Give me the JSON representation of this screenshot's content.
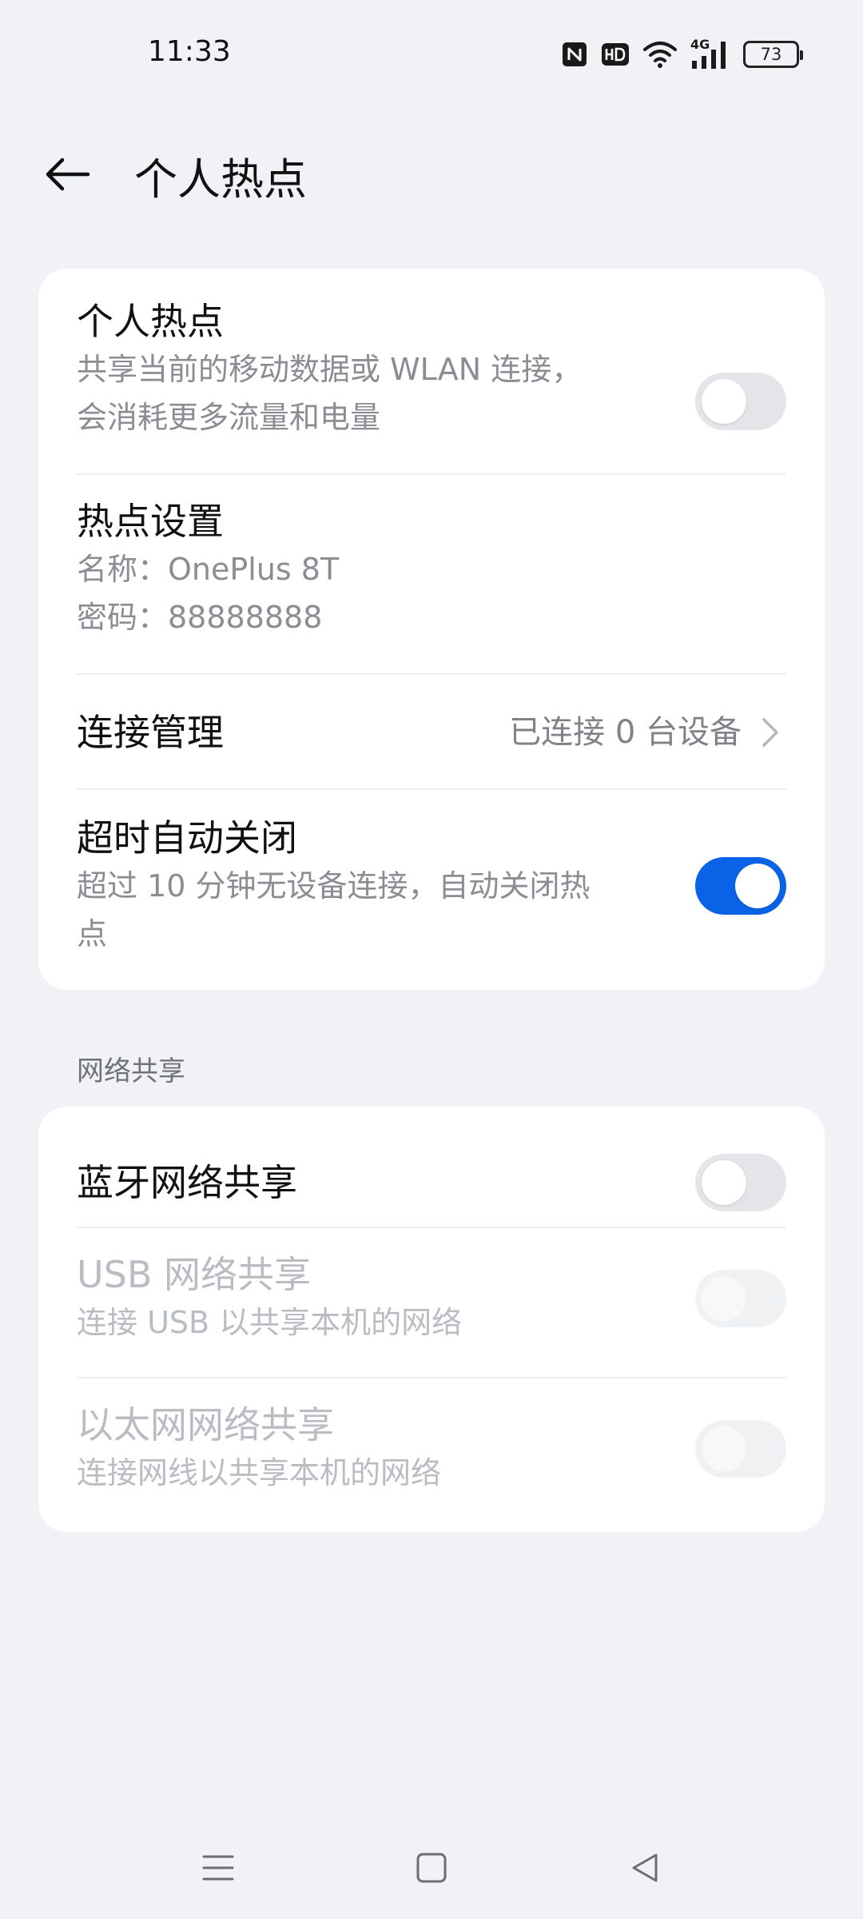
{
  "status_bar": {
    "time": "11:33",
    "network_label": "4G",
    "battery": "73",
    "icons": [
      "nfc-icon",
      "hd-icon",
      "wifi-icon",
      "4g-signal-icon",
      "battery-icon"
    ]
  },
  "header": {
    "title": "个人热点",
    "back_icon": "back-arrow-icon"
  },
  "hotspot_card": {
    "hotspot": {
      "title": "个人热点",
      "subtitle_line1": "共享当前的移动数据或 WLAN 连接，",
      "subtitle_line2": "会消耗更多流量和电量",
      "enabled": false
    },
    "settings": {
      "title": "热点设置",
      "name_line": "名称：OnePlus 8T",
      "password_line": "密码：88888888"
    },
    "connection": {
      "title": "连接管理",
      "value": "已连接 0 台设备"
    },
    "auto_off": {
      "title": "超时自动关闭",
      "subtitle_line1": "超过 10 分钟无设备连接，自动关闭热",
      "subtitle_line2": "点",
      "enabled": true
    }
  },
  "sharing_section": {
    "label": "网络共享",
    "bluetooth": {
      "title": "蓝牙网络共享",
      "enabled": false
    },
    "usb": {
      "title": "USB 网络共享",
      "subtitle": "连接 USB 以共享本机的网络",
      "enabled": false,
      "disabled": true
    },
    "ethernet": {
      "title": "以太网网络共享",
      "subtitle": "连接网线以共享本机的网络",
      "enabled": false,
      "disabled": true
    }
  },
  "colors": {
    "background": "#f1f2f6",
    "card": "#ffffff",
    "accent": "#0a63e6",
    "secondary_text": "#8a8d93",
    "disabled_text": "#b9bcc2"
  },
  "nav_bar": {
    "icons": [
      "menu-icon",
      "home-icon",
      "back-triangle-icon"
    ]
  }
}
